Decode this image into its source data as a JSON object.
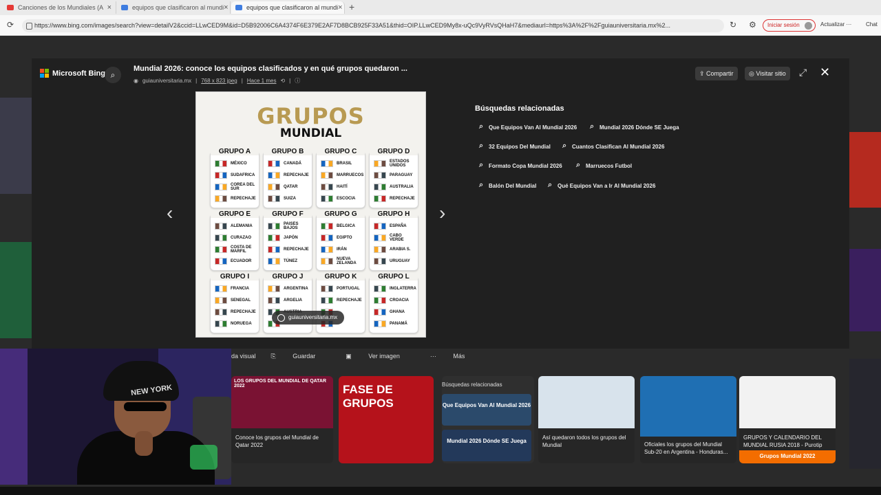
{
  "browser": {
    "tabs": [
      {
        "label": "Canciones de los Mundiales (A",
        "color": "#e53935"
      },
      {
        "label": "equipos que clasificaron al mundi",
        "color": "#3f7de0"
      },
      {
        "label": "equipos que clasificaron al mundi",
        "color": "#3f7de0"
      }
    ],
    "new_tab": "+",
    "url": "https://www.bing.com/images/search?view=detailV2&ccid=LLwCED9M&id=D5B92006C6A4374F6E379E2AF7D8BCB925F33A51&thid=OIP.LLwCED9My8x-uQc9VyRVsQHaH7&mediaurl=https%3A%2F%2Fguiauniversitaria.mx%2...",
    "signin": "Iniciar sesión",
    "update": "Actualizar ···",
    "chat": "Chat"
  },
  "overlay": {
    "logo": "Microsoft Bing",
    "title": "Mundial 2026: conoce los equipos clasificados y en qué grupos quedaron ...",
    "source": "guiauniversitaria.mx",
    "dimensions": "768 x 823 jpeg",
    "age": "Hace 1 mes",
    "share": "Compartir",
    "visit": "Visitar sitio",
    "related_title": "Búsquedas relacionadas",
    "related": [
      "Que Equipos Van Al Mundial 2026",
      "Mundial 2026 Dónde SE Juega",
      "32 Equipos Del Mundial",
      "Cuantos Clasifican Al Mundial 2026",
      "Formato Copa Mundial 2026",
      "Marruecos Futbol",
      "Balón Del Mundial",
      "Qué Equipos Van a Ir Al Mundial 2026"
    ],
    "actions": [
      "ueda visual",
      "Guardar",
      "Ver imagen",
      "Más"
    ]
  },
  "image": {
    "title": "GRUPOS",
    "subtitle": "MUNDIAL",
    "watermark": "guiauniversitaria.mx",
    "groups": [
      {
        "name": "GRUPO A",
        "teams": [
          "MÉXICO",
          "SUDAFRICA",
          "COREA DEL SUR",
          "REPECHAJE"
        ]
      },
      {
        "name": "GRUPO B",
        "teams": [
          "CANADÁ",
          "REPECHAJE",
          "QATAR",
          "SUIZA"
        ]
      },
      {
        "name": "GRUPO C",
        "teams": [
          "BRASIL",
          "MARRUECOS",
          "HAITÍ",
          "ESCOCIA"
        ]
      },
      {
        "name": "GRUPO D",
        "teams": [
          "ESTADOS UNIDOS",
          "PARAGUAY",
          "AUSTRALIA",
          "REPECHAJE"
        ]
      },
      {
        "name": "GRUPO E",
        "teams": [
          "ALEMANIA",
          "CURAZAO",
          "COSTA DE MARFIL",
          "ECUADOR"
        ]
      },
      {
        "name": "GRUPO F",
        "teams": [
          "PAISES BAJOS",
          "JAPÓN",
          "REPECHAJE",
          "TÚNEZ"
        ]
      },
      {
        "name": "GRUPO G",
        "teams": [
          "BELGICA",
          "EGIPTO",
          "IRÁN",
          "NUEVA ZELANDA"
        ]
      },
      {
        "name": "GRUPO H",
        "teams": [
          "ESPAÑA",
          "CABO VERDE",
          "ARABIA S.",
          "URUGUAY"
        ]
      },
      {
        "name": "GRUPO I",
        "teams": [
          "FRANCIA",
          "SENEGAL",
          "REPECHAJE",
          "NORUEGA"
        ]
      },
      {
        "name": "GRUPO J",
        "teams": [
          "ARGENTINA",
          "ARGELIA",
          "AUSTRIA",
          ""
        ]
      },
      {
        "name": "GRUPO K",
        "teams": [
          "PORTUGAL",
          "REPECHAJE",
          "",
          ""
        ]
      },
      {
        "name": "GRUPO L",
        "teams": [
          "INGLATERRA",
          "CROACIA",
          "GHANA",
          "PANAMÁ"
        ]
      }
    ],
    "flag_colors": [
      "#2e7d32",
      "#c62828",
      "#1565c0",
      "#f9a825",
      "#6d4c41",
      "#37474f"
    ]
  },
  "strip": {
    "cards": [
      {
        "caption": "Conoce los grupos del Mundial de Qatar 2022",
        "color": "#7a1233"
      },
      {
        "caption": "",
        "color": "#b5121b"
      },
      {
        "caption": "Así quedaron todos los grupos del Mundial",
        "color": "#d8e3ec"
      },
      {
        "caption": "Oficiales los grupos del Mundial Sub-20 en Argentina - Honduras...",
        "color": "#1f6fb3"
      },
      {
        "caption": "GRUPOS Y CALENDARIO DEL MUNDIAL RUSIA 2018 - Purotip",
        "color": "#f2f2f2"
      }
    ],
    "related_label": "Búsquedas relacionadas",
    "related_cards": [
      "Que Equipos Van Al Mundial 2026",
      "Mundial 2026 Dónde SE Juega"
    ],
    "bottom_badge": "Grupos Mundial 2022",
    "thumb_titles": [
      "LOS GRUPOS DEL MUNDIAL DE QATAR 2022",
      "FASE DE GRUPOS"
    ]
  },
  "webcam": {
    "hat_text": "NEW YORK"
  }
}
